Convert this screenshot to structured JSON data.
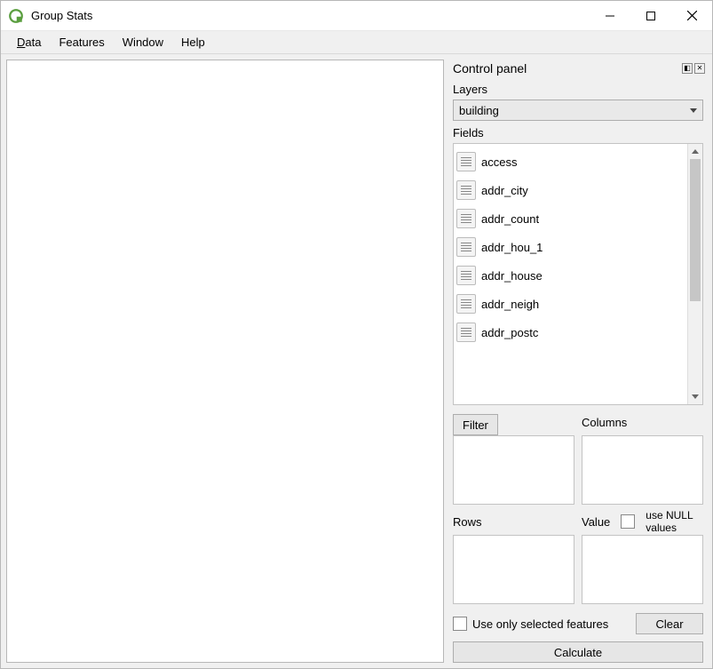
{
  "window": {
    "title": "Group Stats"
  },
  "menu": {
    "data": "Data",
    "features": "Features",
    "window": "Window",
    "help": "Help"
  },
  "panel": {
    "title": "Control panel",
    "layers_label": "Layers",
    "layer_selected": "building",
    "fields_label": "Fields",
    "fields": [
      "access",
      "addr_city",
      "addr_count",
      "addr_hou_1",
      "addr_house",
      "addr_neigh",
      "addr_postc"
    ],
    "filter_button": "Filter",
    "columns_label": "Columns",
    "rows_label": "Rows",
    "value_label": "Value",
    "use_null_label": "use NULL values",
    "use_selected_label": "Use only selected features",
    "clear_button": "Clear",
    "calculate_button": "Calculate"
  }
}
